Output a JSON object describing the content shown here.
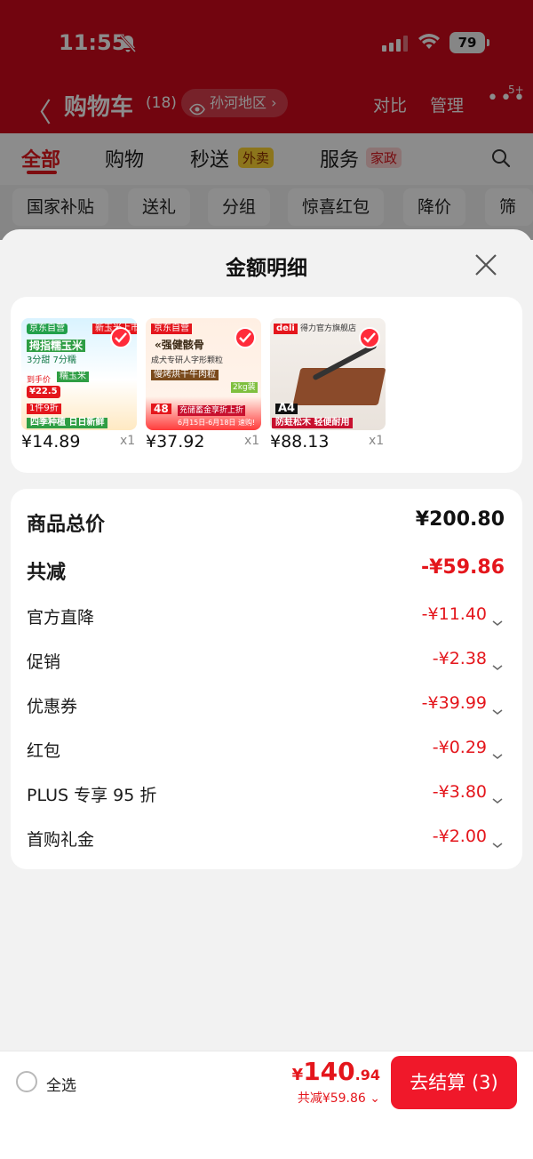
{
  "status_bar": {
    "time": "11:55",
    "battery": "79"
  },
  "nav": {
    "back_glyph": "〈",
    "title": "购物车",
    "count": "(18)",
    "location": "孙河地区 ›",
    "compare": "对比",
    "manage": "管理",
    "more": "•••",
    "badge": "5+"
  },
  "tabs": {
    "all": "全部",
    "shopping": "购物",
    "miaosong": "秒送",
    "waimai_tag": "外卖",
    "service": "服务",
    "jiazheng_tag": "家政"
  },
  "filters": [
    "国家补贴",
    "送礼",
    "分组",
    "惊喜红包",
    "降价",
    "筛选"
  ],
  "sheet": {
    "title": "金额明细",
    "products": [
      {
        "price": "¥14.89",
        "qty": "x1",
        "thumb_texts": [
          "京东自营",
          "新玉米上市",
          "拇指糯玉米",
          "3分甜 7分糯",
          "到手价",
          "¥22.5",
          "1件9折",
          "四季种植 日日新鲜",
          "糯玉米"
        ]
      },
      {
        "price": "¥37.92",
        "qty": "x1",
        "thumb_texts": [
          "京东自营",
          "«强健骸骨",
          "成犬专研人字形颗粒",
          "慢烤烘干牛肉粒",
          "2kg装",
          "48",
          "充储蓄金享折上折",
          "6月15日-6月18日 速购!"
        ]
      },
      {
        "price": "¥88.13",
        "qty": "x1",
        "thumb_texts": [
          "deli",
          "得力官方旗舰店",
          "A4",
          "防蛀松木 轻便耐用"
        ]
      }
    ],
    "summary": {
      "total": {
        "label": "商品总价",
        "value": "¥200.80"
      },
      "reduction": {
        "label": "共减",
        "value": "-¥59.86"
      },
      "items": [
        {
          "label": "官方直降",
          "value": "-¥11.40"
        },
        {
          "label": "促销",
          "value": "-¥2.38"
        },
        {
          "label": "优惠券",
          "value": "-¥39.99"
        },
        {
          "label": "红包",
          "value": "-¥0.29"
        },
        {
          "label": "PLUS 专享 95 折",
          "value": "-¥3.80"
        },
        {
          "label": "首购礼金",
          "value": "-¥2.00"
        }
      ]
    }
  },
  "bottom_bar": {
    "select_all": "全选",
    "price_currency": "¥",
    "price_int": "140",
    "price_dec": ".94",
    "discount": "共减¥59.86 ⌄",
    "checkout": "去结算 (3)"
  },
  "colors": {
    "brand_red": "#e4161c",
    "header_red": "#cf0a1c",
    "button_red": "#f0182a"
  },
  "icons": [
    "bell-off-icon",
    "signal-icon",
    "wifi-icon",
    "battery-icon",
    "back-chevron-icon",
    "eye-icon",
    "search-icon",
    "close-icon",
    "check-icon",
    "chevron-down-icon"
  ]
}
